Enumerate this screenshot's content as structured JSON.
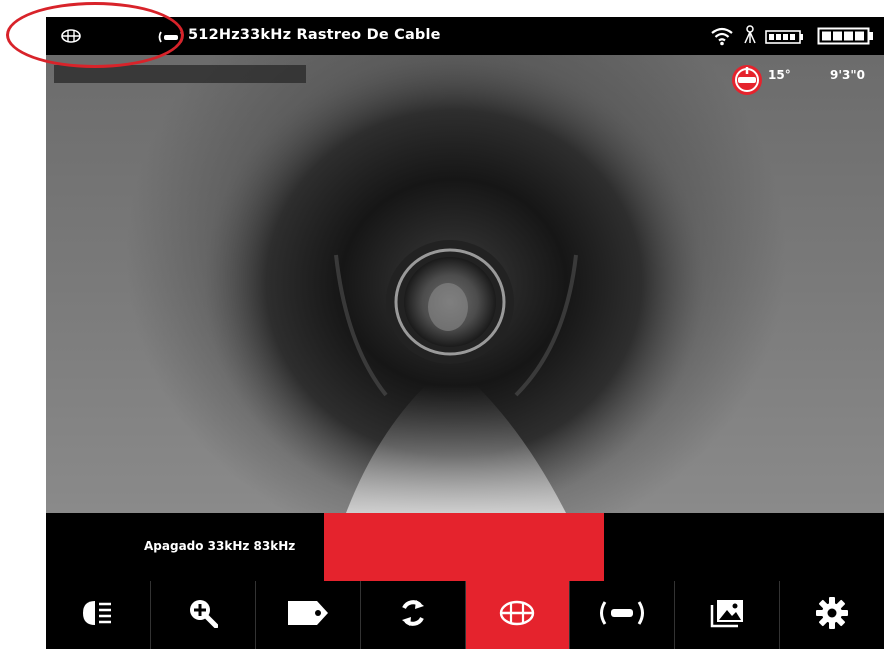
{
  "status_bar": {
    "title": "512Hz33kHz Rastreo De Cable",
    "icons": [
      "sonde-frequency-icon",
      "cable-trace-icon",
      "wifi-icon",
      "tripod-icon",
      "battery-small-icon",
      "battery-icon"
    ]
  },
  "camera_overlay": {
    "angle": "15°",
    "time": "9'3\"0"
  },
  "mode_bar": {
    "label": "Apagado 33kHz 83kHz"
  },
  "toolbar": {
    "buttons": [
      {
        "icon": "light-icon",
        "active": false
      },
      {
        "icon": "zoom-in-icon",
        "active": false
      },
      {
        "icon": "tag-icon",
        "active": false
      },
      {
        "icon": "rotate-icon",
        "active": false
      },
      {
        "icon": "sonde-icon",
        "active": true
      },
      {
        "icon": "line-transmitter-icon",
        "active": false
      },
      {
        "icon": "gallery-icon",
        "active": false
      },
      {
        "icon": "settings-icon",
        "active": false
      }
    ]
  },
  "colors": {
    "accent": "#e5232d",
    "background": "#000000",
    "text": "#ffffff"
  }
}
